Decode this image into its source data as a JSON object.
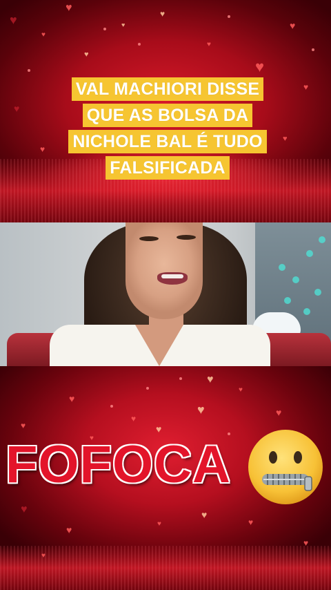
{
  "caption": {
    "lines": [
      "VAL MACHIORI DISSE",
      "QUE AS BOLSA DA",
      "NICHOLE BAL É TUDO",
      "FALSIFICADA"
    ]
  },
  "title_text": "FOFOCA",
  "emoji_icon": "zipper-mouth-face-icon",
  "colors": {
    "caption_bg": "#f6c531",
    "caption_text": "#ffffff",
    "title_red": "#e3142a",
    "background_red": "#b50f1f"
  }
}
